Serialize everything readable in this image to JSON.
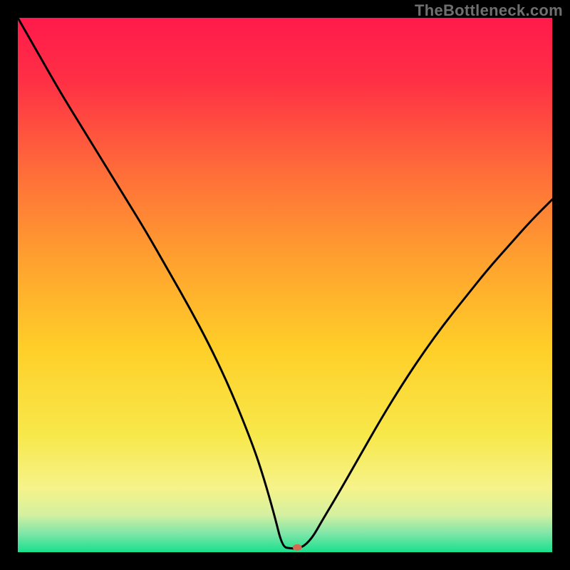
{
  "watermark": "TheBottleneck.com",
  "chart_data": {
    "type": "line",
    "title": "",
    "xlabel": "",
    "ylabel": "",
    "xlim": [
      0,
      100
    ],
    "ylim": [
      0,
      100
    ],
    "background_gradient": {
      "stops": [
        {
          "offset": 0.0,
          "color": "#ff1a4b"
        },
        {
          "offset": 0.12,
          "color": "#ff3045"
        },
        {
          "offset": 0.28,
          "color": "#ff6a3a"
        },
        {
          "offset": 0.45,
          "color": "#ffa02f"
        },
        {
          "offset": 0.62,
          "color": "#ffcf28"
        },
        {
          "offset": 0.78,
          "color": "#f7e84a"
        },
        {
          "offset": 0.88,
          "color": "#f6f38a"
        },
        {
          "offset": 0.93,
          "color": "#d4f0a0"
        },
        {
          "offset": 0.965,
          "color": "#7ee6a8"
        },
        {
          "offset": 1.0,
          "color": "#18e08e"
        }
      ]
    },
    "series": [
      {
        "name": "bottleneck-curve",
        "color": "#000000",
        "x": [
          0,
          4,
          8,
          12,
          16,
          20,
          24,
          28,
          32,
          36,
          40,
          44,
          46,
          48,
          49.5,
          51,
          53,
          55,
          57,
          60,
          64,
          68,
          72,
          76,
          80,
          84,
          88,
          92,
          96,
          100
        ],
        "y": [
          100,
          93,
          86,
          79.5,
          73,
          66.5,
          60,
          53,
          46,
          38.5,
          30,
          20,
          14,
          7,
          1.0,
          0.7,
          0.7,
          2.5,
          6,
          11,
          18,
          25,
          31.5,
          37.5,
          43,
          48,
          53,
          57.5,
          62,
          66
        ]
      }
    ],
    "marker": {
      "name": "min-point-marker",
      "x": 52.3,
      "y": 0.9,
      "rx": 6.5,
      "ry": 4.5,
      "fill": "#d46a52"
    }
  }
}
